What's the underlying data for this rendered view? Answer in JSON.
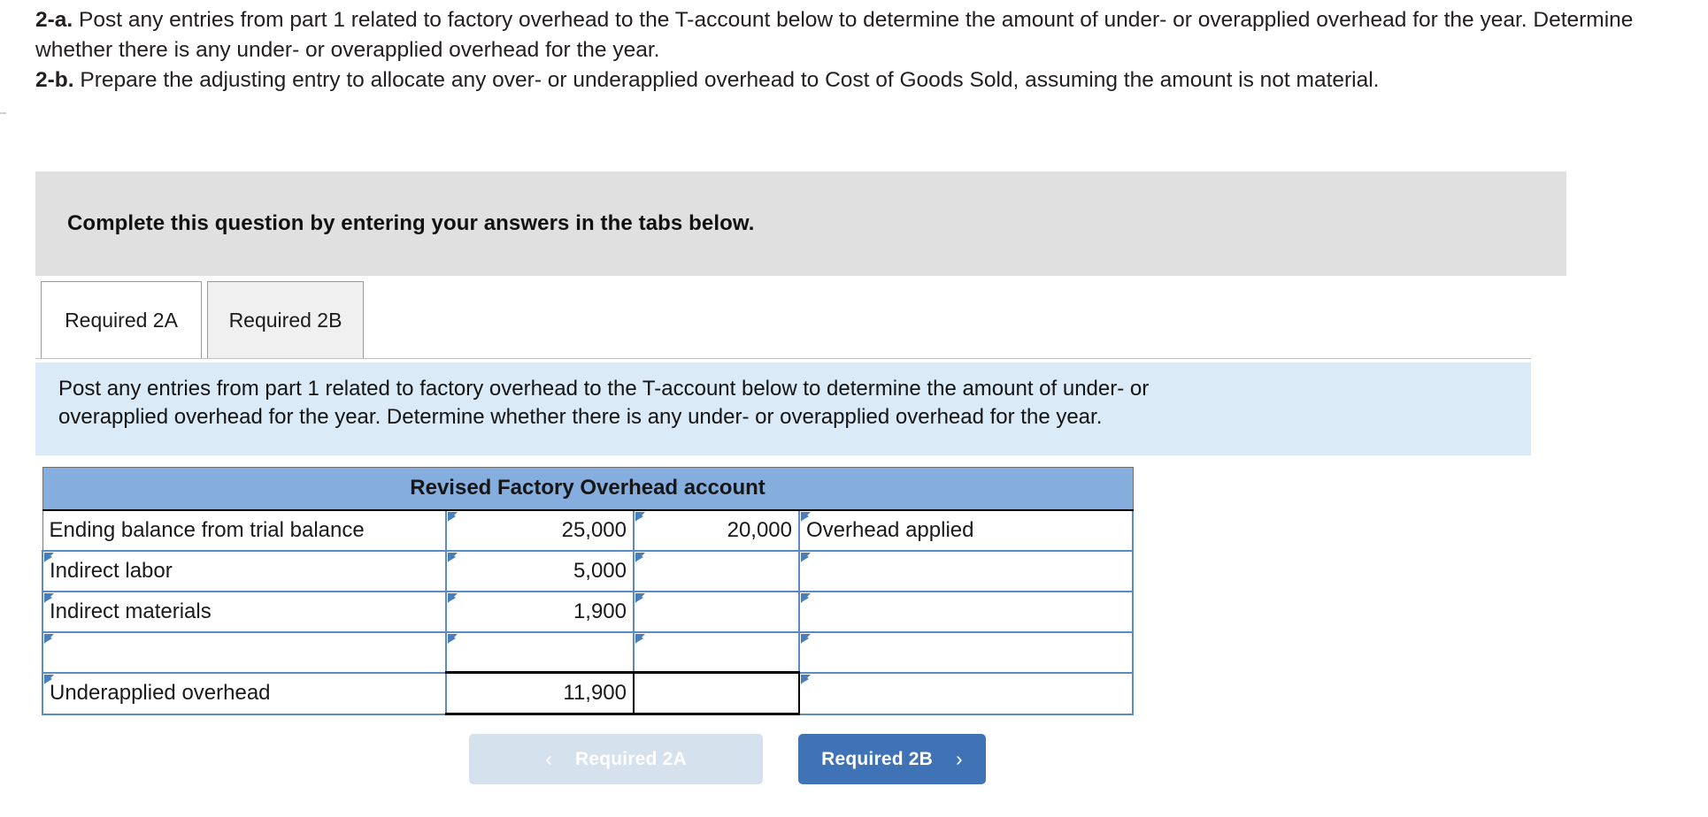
{
  "prompt": {
    "part_a_label": "2-a.",
    "part_a_text": " Post any entries from part 1 related to factory overhead to the T-account below to determine the amount of under- or overapplied overhead for the year. Determine whether there is any under- or overapplied overhead for the year.",
    "part_b_label": "2-b.",
    "part_b_text": " Prepare the adjusting entry to allocate any over- or underapplied overhead to Cost of Goods Sold, assuming the amount is not material."
  },
  "banner": {
    "text": "Complete this question by entering your answers in the tabs below."
  },
  "tabs": [
    {
      "label": "Required 2A",
      "active": true
    },
    {
      "label": "Required 2B",
      "active": false
    }
  ],
  "info": {
    "line1": "Post any entries from part 1 related to factory overhead to the T-account below to determine the amount of under- or",
    "line2": "overapplied overhead for the year. Determine whether there is any under- or overapplied overhead for the year."
  },
  "table": {
    "title": "Revised Factory Overhead account",
    "rows": [
      {
        "debit_label": "Ending balance from trial balance",
        "debit_amount": "25,000",
        "credit_amount": "20,000",
        "credit_label": "Overhead applied"
      },
      {
        "debit_label": "Indirect labor",
        "debit_amount": "5,000",
        "credit_amount": "",
        "credit_label": ""
      },
      {
        "debit_label": "Indirect materials",
        "debit_amount": "1,900",
        "credit_amount": "",
        "credit_label": ""
      },
      {
        "debit_label": "",
        "debit_amount": "",
        "credit_amount": "",
        "credit_label": ""
      },
      {
        "debit_label": "Underapplied overhead",
        "debit_amount": "11,900",
        "credit_amount": "",
        "credit_label": ""
      }
    ]
  },
  "footer": {
    "prev_label": "Required 2A",
    "prev_chevron": "‹",
    "next_label": "Required 2B",
    "next_chevron": "›"
  },
  "colors": {
    "banner_bg": "#e0e0e0",
    "info_bg": "#dbeaf7",
    "table_header_bg": "#85aedf",
    "cell_border_blue": "#5b8bc4",
    "flag_blue": "#4a7ebb",
    "btn_next_bg": "#4073b5",
    "btn_prev_bg": "#d6e1ee"
  }
}
